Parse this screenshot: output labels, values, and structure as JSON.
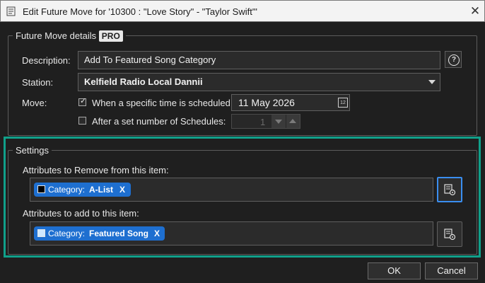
{
  "window": {
    "title": "Edit Future Move for '10300 : \"Love Story\" - \"Taylor Swift\"'",
    "close_glyph": "✕",
    "icon": "app-document-icon"
  },
  "future_move": {
    "group_label": "Future Move details",
    "pro_badge": "PRO",
    "description_label": "Description:",
    "description_value": "Add To Featured Song Category",
    "help_glyph": "?",
    "station_label": "Station:",
    "station_value": "Kelfield Radio Local Dannii",
    "move_label": "Move:",
    "option_time_label": "When a specific time is scheduled:",
    "option_time_checked": true,
    "date_value": "11 May 2026",
    "calendar_day": "12",
    "option_schedules_label": "After a set number of Schedules:",
    "option_schedules_checked": false,
    "schedules_count": "1"
  },
  "settings": {
    "group_label": "Settings",
    "remove_label": "Attributes to Remove from this item:",
    "remove_tag": {
      "prefix": "Category:",
      "value": "A-List",
      "remove": "X",
      "swatch": "#000000"
    },
    "add_label": "Attributes to add to this item:",
    "add_tag": {
      "prefix": "Category:",
      "value": "Featured Song",
      "remove": "X",
      "swatch": "#cfe8ff"
    }
  },
  "buttons": {
    "ok": "OK",
    "cancel": "Cancel"
  },
  "colors": {
    "accent": "#1e6fd0",
    "highlight": "#10a08a",
    "background": "#1f1f1f"
  }
}
